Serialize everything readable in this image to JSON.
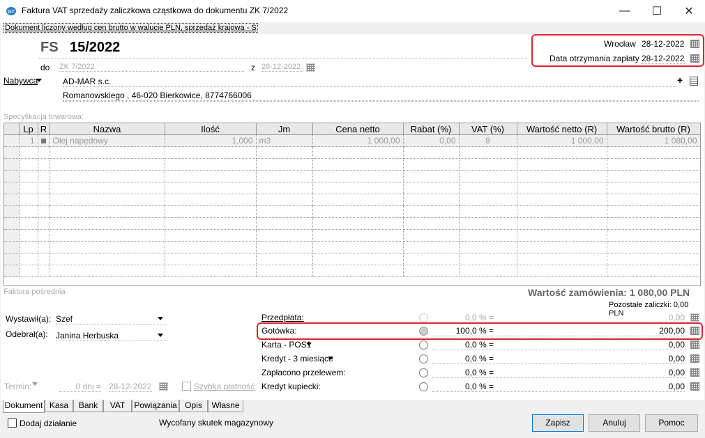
{
  "window": {
    "title": "Faktura VAT sprzedaży zaliczkowa cząstkowa do dokumentu ZK 7/2022",
    "minimize": "—",
    "maximize": "☐",
    "close": "✕"
  },
  "info_line": "Dokument liczony według cen brutto w walucie PLN, sprzedaż krajowa - S",
  "doc": {
    "type": "FS",
    "number": "15/2022",
    "do_label": "do",
    "do_value": "ZK 7/2022",
    "z_label": "z",
    "z_value": "28-12-2022",
    "place": "Wrocław",
    "place_date": "28-12-2022",
    "payment_date_label": "Data otrzymania zapłaty",
    "payment_date": "28-12-2022"
  },
  "buyer": {
    "label": "Nabywca",
    "name": "AD-MAR s.c.",
    "address": "Romanowskiego , 46-020 Bierkowice, 8774766006",
    "add_symbol": "+"
  },
  "spec_label": "Specyfikacja towarowa:",
  "table": {
    "columns": [
      "Lp",
      "R",
      "Nazwa",
      "Ilość",
      "Jm",
      "Cena netto",
      "Rabat (%)",
      "VAT (%)",
      "Wartość netto (R)",
      "Wartość brutto (R)"
    ],
    "rows": [
      [
        "1",
        "",
        "Olej napędowy",
        "1,000",
        "m3",
        "1 000,00",
        "0,00",
        "8",
        "1 000,00",
        "1 080,00"
      ]
    ]
  },
  "faktura_posrednia": "Faktura pośrednia",
  "order_value": "Wartość zamówienia: 1 080,00 PLN",
  "remaining": "Pozostałe zaliczki: 0,00 PLN",
  "wystawil_label": "Wystawił(a):",
  "wystawil_value": "Szef",
  "odebral_label": "Odebrał(a):",
  "odebral_value": "Janina Herbuska",
  "termin": {
    "label": "Termin:",
    "days": "0 dni =",
    "date": "28-12-2022",
    "quick_label": "Szybka płatność"
  },
  "payments": [
    {
      "label": "Przedpłata:",
      "percent": "0,0 % =",
      "amount": "0,00"
    },
    {
      "label": "Gotówka:",
      "percent": "100,0 % =",
      "amount": "200,00"
    },
    {
      "label": "Karta - POS1",
      "percent": "0,0 % =",
      "amount": "0,00"
    },
    {
      "label": "Kredyt - 3 miesiące",
      "percent": "0,0 % =",
      "amount": "0,00"
    },
    {
      "label": "Zapłacono przelewem:",
      "percent": "0,0 % =",
      "amount": "0,00"
    },
    {
      "label": "Kredyt kupiecki:",
      "percent": "0,0 % =",
      "amount": "0,00"
    }
  ],
  "tabs": [
    "Dokument",
    "Kasa",
    "Bank",
    "VAT",
    "Powiązania",
    "Opis",
    "Własne"
  ],
  "footer": {
    "add_action": "Dodaj działanie",
    "status": "Wycofany skutek magazynowy",
    "save": "Zapisz",
    "cancel": "Anuluj",
    "help": "Pomoc"
  }
}
